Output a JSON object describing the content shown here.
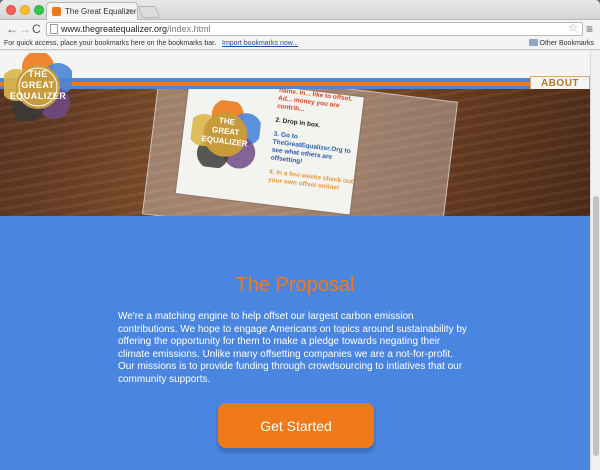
{
  "browser": {
    "tab_title": "The Great Equalizer",
    "tab_close": "×",
    "url_domain": "www.thegreatequalizer.org",
    "url_path": "/index.html",
    "bookmarks_prompt": "For quick access, place your bookmarks here on the bookmarks bar.",
    "bookmarks_link": "Import bookmarks now...",
    "other_bookmarks": "Other Bookmarks",
    "icons": {
      "back": "←",
      "forward": "→",
      "reload": "C",
      "star": "☆",
      "menu": "≡"
    }
  },
  "site": {
    "logo": {
      "line1": "THE",
      "line2": "GREAT",
      "line3": "EQUALIZER"
    },
    "nav": {
      "about": "ABOUT"
    },
    "hero_card": {
      "logo_line1": "THE",
      "logo_line2": "GREAT",
      "logo_line3": "EQUALIZER",
      "text_red": "name. In... like to offset. Ad... money you are contrib...",
      "text_step2": "2. Drop in box.",
      "text_step3": "3. Go to TheGreatEqualizer.Org to see what others are offsetting!",
      "text_step4": "4. In a few weeks check out your own offset online!"
    },
    "proposal": {
      "title": "The Proposal",
      "body": "We're a matching engine to help offset our largest carbon emission contributions. We hope to engage Americans on topics around sustainability by offering the opportunity for them to make a pledge towards negating their climate emissions. Unlike many offsetting companies we are a not-for-profit. Our missions is to provide funding through crowdsourcing to intiatives that our community supports.",
      "cta": "Get Started"
    }
  },
  "colors": {
    "brand_orange": "#f07a1a",
    "brand_blue": "#4a86e0",
    "about_text": "#b07a2a"
  }
}
